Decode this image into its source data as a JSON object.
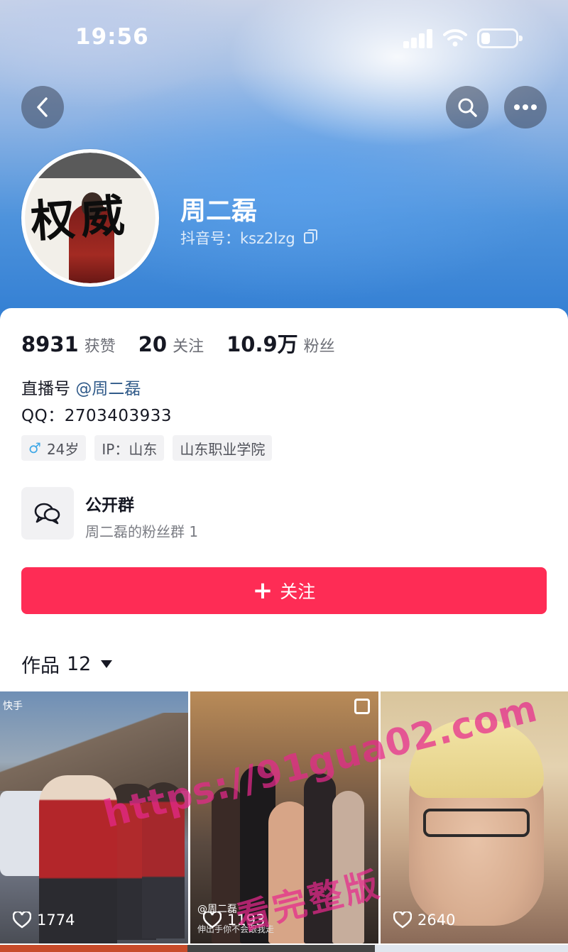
{
  "status_bar": {
    "time": "19:56"
  },
  "nav": {
    "back_icon": "chevron-left-icon",
    "search_icon": "search-icon",
    "more_icon": "more-horizontal-icon"
  },
  "profile": {
    "avatar_text": "权威",
    "name": "周二磊",
    "douyin_id": "抖音号：ksz2lzg"
  },
  "stats": [
    {
      "value": "8931",
      "label": "获赞"
    },
    {
      "value": "20",
      "label": "关注"
    },
    {
      "value": "10.9万",
      "label": "粉丝"
    }
  ],
  "bio": {
    "live_prefix": "直播号 ",
    "live_mention": "@周二磊",
    "qq": "QQ：2703403933"
  },
  "tags": {
    "gender_symbol": "♂",
    "age": "24岁",
    "ip": "IP：山东",
    "school": "山东职业学院"
  },
  "group": {
    "title": "公开群",
    "subtitle": "周二磊的粉丝群 1"
  },
  "follow_button": {
    "plus": "+",
    "label": "关注"
  },
  "works": {
    "label": "作品",
    "count": "12"
  },
  "videos": [
    {
      "likes": "1774",
      "corner_text": "快手"
    },
    {
      "likes": "1193",
      "overlay_text": "@周二磊",
      "overlay_sub": "伸出手你不会跟我走"
    },
    {
      "likes": "2640"
    }
  ],
  "watermark": {
    "url": "https://91gua02.com",
    "text": "看完整版"
  },
  "colors": {
    "accent": "#fe2c55",
    "mention": "#315b8a",
    "watermark": "#e6288c"
  }
}
